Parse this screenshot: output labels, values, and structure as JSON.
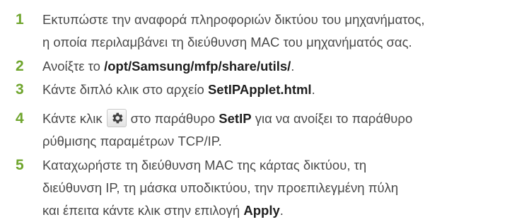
{
  "steps": [
    {
      "number": "1",
      "line1": "Εκτυπώστε την αναφορά πληροφοριών δικτύου του μηχανήματος,",
      "line2": "η οποία περιλαμβάνει τη διεύθυνση MAC του μηχανήματός σας."
    },
    {
      "number": "2",
      "pre": "Ανοίξτε το ",
      "bold": "/opt/Samsung/mfp/share/utils/",
      "post": "."
    },
    {
      "number": "3",
      "pre": "Κάντε διπλό κλικ στο αρχείο ",
      "bold": "SetIPApplet.html",
      "post": "."
    },
    {
      "number": "4",
      "pre": "Κάντε κλικ",
      "mid": "στο παράθυρο ",
      "bold": "SetIP",
      "post": " για να ανοίξει το παράθυρο",
      "line2": "ρύθμισης παραμέτρων TCP/IP.",
      "icon": "gear-icon"
    },
    {
      "number": "5",
      "line1": "Καταχωρήστε τη διεύθυνση MAC της κάρτας δικτύου, τη",
      "line2": "διεύθυνση IP, τη μάσκα υποδικτύου, την προεπιλεγμένη πύλη",
      "line3_pre": "και έπειτα κάντε κλικ στην επιλογή ",
      "line3_bold": "Apply",
      "line3_post": "."
    }
  ],
  "colors": {
    "number": "#6fa52d",
    "text": "#4a4a4a",
    "bold_text": "#1f1f1f"
  }
}
